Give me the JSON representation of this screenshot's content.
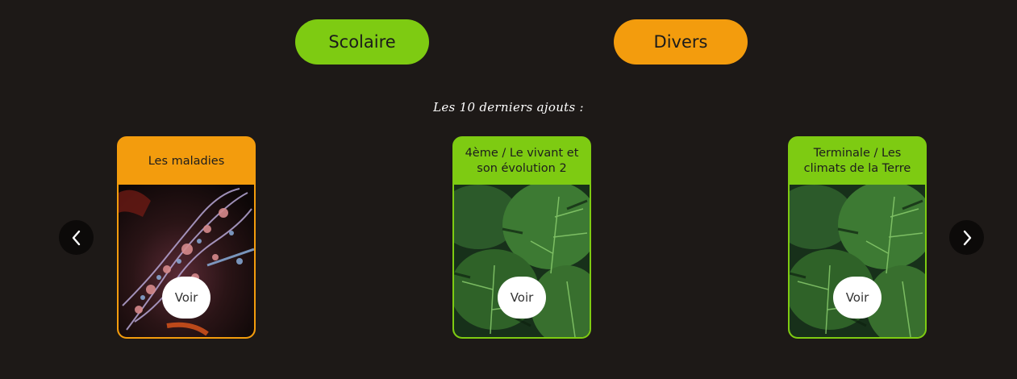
{
  "categories": {
    "scolaire_label": "Scolaire",
    "divers_label": "Divers"
  },
  "section": {
    "title": "Les 10 derniers ajouts :"
  },
  "cards": [
    {
      "title": "Les maladies",
      "button_label": "Voir",
      "theme": "orange",
      "image": "virus-image"
    },
    {
      "title": "4ème / Le vivant et son évolution 2",
      "button_label": "Voir",
      "theme": "green",
      "image": "monstera-leaves-image"
    },
    {
      "title": "Terminale / Les climats de la Terre",
      "button_label": "Voir",
      "theme": "green",
      "image": "monstera-leaves-image"
    }
  ],
  "colors": {
    "background": "#1d1917",
    "green": "#7ecb12",
    "orange": "#f39c0d"
  },
  "icons": {
    "prev": "chevron-left-icon",
    "next": "chevron-right-icon"
  }
}
